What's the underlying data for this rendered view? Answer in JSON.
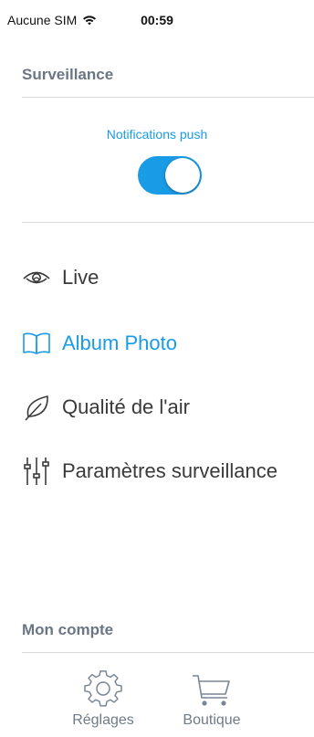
{
  "status_bar": {
    "carrier": "Aucune SIM",
    "time": "00:59"
  },
  "surveillance": {
    "title": "Surveillance",
    "push_label": "Notifications push",
    "push_enabled": true
  },
  "menu": {
    "items": [
      {
        "label": "Live",
        "icon": "eye-icon",
        "active": false
      },
      {
        "label": "Album Photo",
        "icon": "book-icon",
        "active": true
      },
      {
        "label": "Qualité de l'air",
        "icon": "leaf-icon",
        "active": false
      },
      {
        "label": "Paramètres surveillance",
        "icon": "sliders-icon",
        "active": false
      }
    ]
  },
  "account": {
    "title": "Mon compte"
  },
  "tabs": [
    {
      "label": "Réglages",
      "icon": "gear-icon"
    },
    {
      "label": "Boutique",
      "icon": "cart-icon"
    }
  ],
  "colors": {
    "accent": "#1a9be6",
    "section_title": "#6b7684",
    "text": "#3a3a3a",
    "divider": "#d9d9d9"
  }
}
